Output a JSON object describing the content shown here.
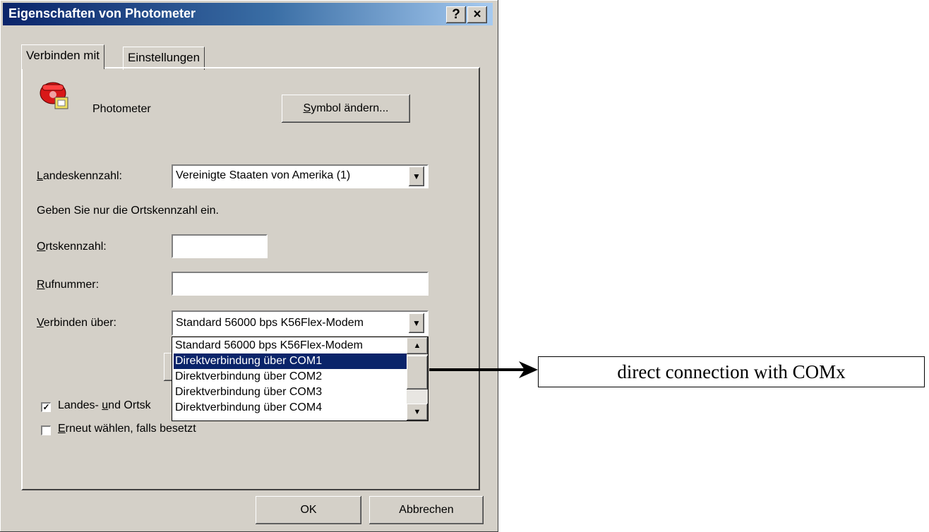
{
  "window": {
    "title": "Eigenschaften von Photometer",
    "help_glyph": "?",
    "close_glyph": "×"
  },
  "tabs": [
    {
      "label": "Verbinden mit"
    },
    {
      "label": "Einstellungen"
    }
  ],
  "header": {
    "name": "Photometer",
    "change_icon_button": {
      "mnemonic": "S",
      "rest": "ymbol ändern..."
    }
  },
  "country": {
    "label_mnemonic": "L",
    "label_rest": "andeskennzahl:",
    "value": "Vereinigte Staaten von Amerika (1)"
  },
  "hint": "Geben Sie nur die Ortskennzahl ein.",
  "area_code": {
    "label_mnemonic": "O",
    "label_rest": "rtskennzahl:",
    "value": ""
  },
  "phone": {
    "label_mnemonic": "R",
    "label_rest": "ufnummer:",
    "value": ""
  },
  "connect_via": {
    "label_mnemonic": "V",
    "label_rest": "erbinden über:",
    "value": "Standard 56000 bps K56Flex-Modem",
    "options": [
      "Standard 56000 bps K56Flex-Modem",
      "Direktverbindung über COM1",
      "Direktverbindung über COM2",
      "Direktverbindung über COM3",
      "Direktverbindung über COM4"
    ],
    "selected_index": 1
  },
  "checkboxes": [
    {
      "pre": "Landes- ",
      "mnemonic": "u",
      "post": "nd Ortsk",
      "checked": true
    },
    {
      "pre": "",
      "mnemonic": "E",
      "post": "rneut wählen, falls besetzt",
      "checked": false
    }
  ],
  "buttons": {
    "ok": "OK",
    "cancel": "Abbrechen"
  },
  "annotation": "direct connection with COMx",
  "colors": {
    "titlebar": "#0a246a",
    "face": "#d4d0c8",
    "selection": "#0a246a"
  }
}
